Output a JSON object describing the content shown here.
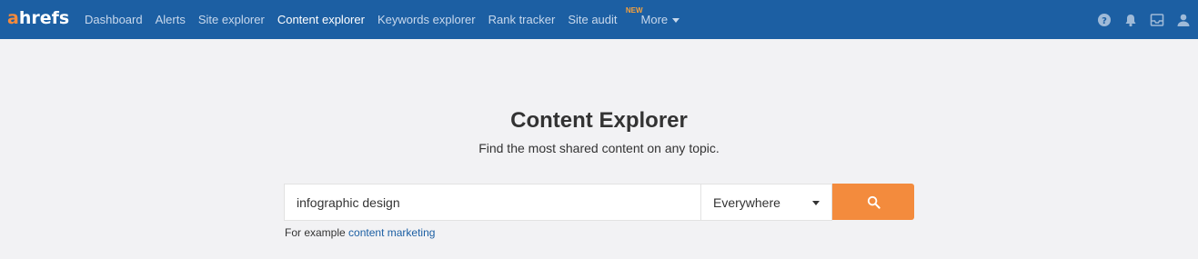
{
  "brand": {
    "logo_first": "a",
    "logo_rest": "hrefs",
    "accent_color": "#f58a3c",
    "nav_color": "#1c5fa3"
  },
  "nav": {
    "items": [
      {
        "label": "Dashboard"
      },
      {
        "label": "Alerts"
      },
      {
        "label": "Site explorer"
      },
      {
        "label": "Content explorer",
        "active": true
      },
      {
        "label": "Keywords explorer"
      },
      {
        "label": "Rank tracker"
      },
      {
        "label": "Site audit",
        "badge": "NEW"
      },
      {
        "label": "More"
      }
    ],
    "icons": [
      "help-icon",
      "bell-icon",
      "inbox-icon",
      "user-icon"
    ]
  },
  "main": {
    "title": "Content Explorer",
    "subtitle": "Find the most shared content on any topic."
  },
  "search": {
    "value": "infographic design",
    "scope": "Everywhere",
    "button_icon": "search-icon",
    "button_color": "#f38b3d"
  },
  "example": {
    "prefix": "For example",
    "link": "content marketing"
  }
}
